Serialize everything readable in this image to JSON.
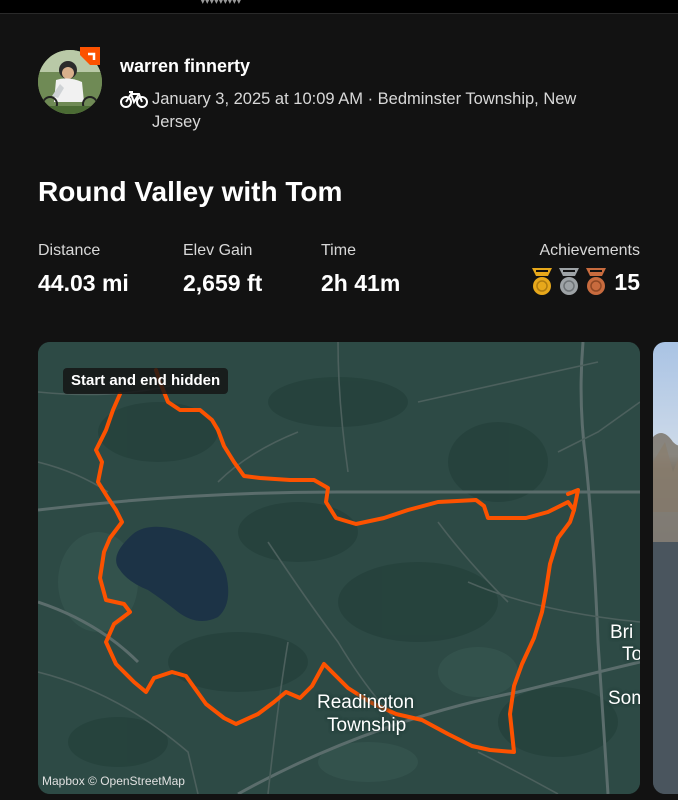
{
  "athlete": {
    "name": "warren finnerty",
    "datetime_location": "January 3, 2025 at 10:09 AM · Bedminster Township, New Jersey",
    "activity_icon": "bike-icon"
  },
  "activity": {
    "title": "Round Valley with Tom"
  },
  "stats": {
    "distance": {
      "label": "Distance",
      "value": "44.03 mi"
    },
    "elev_gain": {
      "label": "Elev Gain",
      "value": "2,659 ft"
    },
    "time": {
      "label": "Time",
      "value": "2h 41m"
    },
    "achievements": {
      "label": "Achievements",
      "count": "15",
      "medals": [
        "gold-medal-icon",
        "silver-medal-icon",
        "bronze-medal-icon"
      ]
    }
  },
  "map": {
    "hidden_notice": "Start and end hidden",
    "attribution": "Mapbox © OpenStreetMap",
    "place_main_line1": "Readington",
    "place_main_line2": "Township",
    "place_edge_1": "Bri",
    "place_edge_2": "To",
    "place_edge_3": "Som",
    "route_color": "#fc5200"
  },
  "colors": {
    "background": "#121212",
    "brand": "#fc5200",
    "gold": "#e7a81b",
    "silver": "#9ea3a6",
    "bronze": "#c86b3e"
  }
}
